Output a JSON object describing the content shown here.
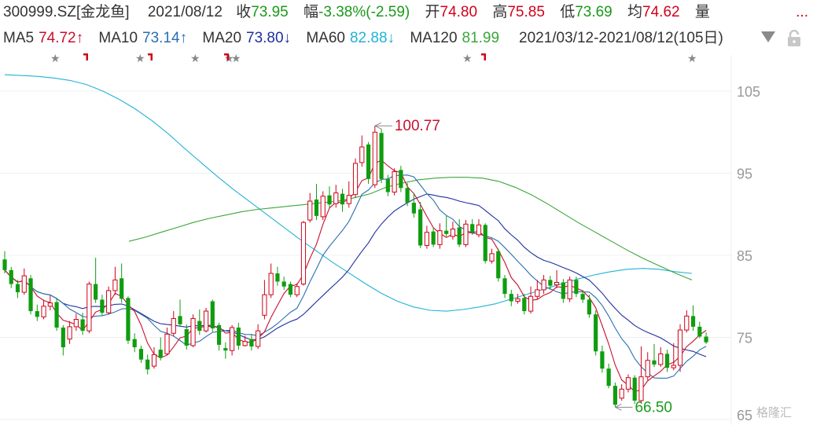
{
  "header": {
    "symbol": "300999.SZ[金龙鱼]",
    "date": "2021/08/12",
    "close_label": "收",
    "close": "73.95",
    "change_label": "幅",
    "change": "-3.38%(-2.59)",
    "open_label": "开",
    "open": "74.80",
    "high_label": "高",
    "high": "75.85",
    "low_label": "低",
    "low": "73.69",
    "avg_label": "均",
    "avg": "74.62",
    "vol_label": "量",
    "more": "..."
  },
  "ma_bar": {
    "items": [
      {
        "name": "MA5",
        "value": "74.72↑",
        "color": "#c8102e"
      },
      {
        "name": "MA10",
        "value": "73.14↑",
        "color": "#2a6fb0"
      },
      {
        "name": "MA20",
        "value": "73.80↓",
        "color": "#1f2fa0"
      },
      {
        "name": "MA60",
        "value": "82.88↓",
        "color": "#22b3d6"
      },
      {
        "name": "MA120",
        "value": "81.99",
        "color": "#3aa63a"
      }
    ],
    "range": "2021/03/12-2021/08/12(105日)"
  },
  "icons": {
    "dropdown": "triangle-down-icon",
    "lock": "lock-icon"
  },
  "watermark": "格隆汇",
  "colors": {
    "up": "#d0021b",
    "down": "#0f9d0f",
    "ma5": "#c8102e",
    "ma10": "#2a6fb0",
    "ma20": "#1f2fa0",
    "ma60": "#22b3d6",
    "ma120": "#3aa63a"
  },
  "chart_data": {
    "type": "candlestick",
    "y_ticks": [
      "105",
      "95",
      "85",
      "75",
      "65"
    ],
    "ylim": [
      64,
      110
    ],
    "annotations": [
      {
        "text": "100.77",
        "value": 100.77,
        "kind": "high"
      },
      {
        "text": "66.50",
        "value": 66.5,
        "kind": "low"
      }
    ],
    "candles": [
      [
        84.5,
        83.2,
        85.5,
        82.8
      ],
      [
        83.2,
        81.5,
        83.6,
        81.0
      ],
      [
        81.5,
        80.5,
        82.0,
        79.8
      ],
      [
        80.5,
        82.5,
        83.4,
        80.2
      ],
      [
        82.2,
        78.2,
        82.6,
        77.8
      ],
      [
        78.2,
        77.5,
        79.0,
        77.0
      ],
      [
        77.5,
        78.8,
        79.6,
        77.2
      ],
      [
        78.8,
        79.2,
        80.1,
        78.3
      ],
      [
        79.3,
        76.2,
        79.8,
        75.8
      ],
      [
        76.2,
        73.8,
        76.5,
        72.8
      ],
      [
        74.8,
        76.3,
        77.0,
        74.2
      ],
      [
        76.3,
        77.2,
        77.9,
        75.8
      ],
      [
        77.2,
        75.8,
        78.0,
        75.3
      ],
      [
        75.8,
        81.5,
        81.8,
        75.5
      ],
      [
        81.5,
        79.6,
        84.7,
        79.2
      ],
      [
        79.6,
        78.0,
        80.2,
        77.6
      ],
      [
        78.0,
        80.7,
        81.2,
        77.8
      ],
      [
        80.7,
        82.0,
        83.6,
        80.2
      ],
      [
        82.2,
        79.7,
        84.0,
        79.2
      ],
      [
        79.8,
        74.6,
        80.0,
        74.2
      ],
      [
        74.8,
        73.8,
        75.5,
        73.2
      ],
      [
        73.6,
        72.3,
        74.0,
        71.9
      ],
      [
        72.3,
        71.1,
        72.9,
        70.5
      ],
      [
        71.5,
        72.9,
        73.8,
        71.2
      ],
      [
        73.5,
        72.5,
        75.0,
        72.2
      ],
      [
        73.0,
        75.4,
        76.2,
        72.8
      ],
      [
        75.5,
        77.3,
        78.2,
        75.1
      ],
      [
        77.6,
        76.6,
        79.6,
        76.3
      ],
      [
        76.0,
        74.0,
        76.6,
        73.5
      ],
      [
        74.0,
        77.3,
        77.8,
        73.8
      ],
      [
        77.0,
        75.8,
        78.4,
        75.3
      ],
      [
        75.8,
        78.2,
        78.6,
        75.6
      ],
      [
        79.4,
        76.1,
        79.6,
        75.7
      ],
      [
        76.5,
        74.1,
        76.8,
        73.4
      ],
      [
        73.7,
        73.4,
        74.4,
        72.4
      ],
      [
        73.4,
        76.2,
        76.5,
        72.8
      ],
      [
        76.2,
        74.0,
        76.8,
        73.5
      ],
      [
        74.0,
        74.5,
        75.2,
        73.9
      ],
      [
        74.8,
        73.9,
        75.4,
        73.4
      ],
      [
        73.9,
        75.8,
        76.6,
        73.6
      ],
      [
        77.7,
        80.2,
        82.0,
        77.2
      ],
      [
        80.2,
        82.8,
        84.0,
        79.8
      ],
      [
        82.8,
        81.8,
        83.6,
        81.3
      ],
      [
        81.8,
        81.2,
        82.4,
        80.8
      ],
      [
        81.5,
        80.2,
        81.8,
        79.9
      ],
      [
        80.2,
        81.2,
        81.6,
        79.9
      ],
      [
        81.5,
        89.0,
        89.2,
        81.3
      ],
      [
        89.3,
        91.6,
        92.6,
        89.0
      ],
      [
        91.8,
        89.8,
        93.7,
        89.3
      ],
      [
        89.7,
        92.2,
        92.8,
        89.3
      ],
      [
        92.3,
        91.2,
        93.4,
        90.8
      ],
      [
        91.3,
        92.6,
        93.6,
        90.8
      ],
      [
        92.5,
        91.2,
        93.1,
        90.3
      ],
      [
        91.3,
        92.3,
        94.0,
        90.8
      ],
      [
        92.4,
        96.2,
        96.8,
        92.0
      ],
      [
        96.3,
        98.2,
        99.6,
        95.8
      ],
      [
        98.5,
        94.3,
        98.8,
        93.7
      ],
      [
        93.6,
        100.0,
        100.77,
        93.2
      ],
      [
        99.9,
        94.3,
        100.4,
        93.8
      ],
      [
        94.3,
        92.7,
        94.8,
        92.2
      ],
      [
        92.7,
        95.2,
        95.6,
        92.3
      ],
      [
        95.4,
        93.2,
        95.9,
        92.7
      ],
      [
        93.2,
        91.4,
        93.8,
        91.0
      ],
      [
        91.4,
        90.1,
        92.6,
        89.6
      ],
      [
        90.6,
        86.2,
        91.5,
        85.9
      ],
      [
        86.2,
        87.8,
        88.6,
        85.8
      ],
      [
        87.9,
        86.3,
        88.4,
        86.0
      ],
      [
        86.3,
        88.0,
        88.9,
        85.8
      ],
      [
        88.0,
        87.6,
        89.8,
        87.3
      ],
      [
        87.3,
        88.2,
        89.1,
        86.9
      ],
      [
        88.4,
        86.3,
        89.4,
        86.0
      ],
      [
        86.3,
        88.8,
        89.3,
        86.0
      ],
      [
        88.8,
        87.8,
        89.4,
        87.5
      ],
      [
        87.5,
        88.7,
        89.4,
        87.2
      ],
      [
        88.7,
        84.3,
        88.9,
        84.0
      ],
      [
        84.3,
        85.2,
        85.8,
        84.0
      ],
      [
        85.5,
        82.2,
        85.8,
        81.8
      ],
      [
        82.2,
        80.3,
        82.6,
        79.8
      ],
      [
        80.3,
        79.4,
        80.8,
        78.8
      ],
      [
        79.4,
        79.7,
        80.3,
        79.1
      ],
      [
        79.8,
        78.2,
        80.3,
        77.8
      ],
      [
        78.2,
        80.0,
        81.2,
        77.9
      ],
      [
        80.0,
        80.8,
        82.0,
        79.6
      ],
      [
        80.8,
        82.0,
        82.6,
        80.3
      ],
      [
        82.0,
        81.3,
        82.5,
        80.8
      ],
      [
        81.4,
        81.7,
        83.2,
        81.0
      ],
      [
        81.7,
        79.7,
        82.1,
        79.2
      ],
      [
        79.7,
        82.0,
        82.4,
        79.3
      ],
      [
        82.0,
        80.3,
        82.4,
        79.9
      ],
      [
        80.3,
        79.6,
        80.8,
        79.2
      ],
      [
        79.6,
        77.8,
        80.2,
        77.4
      ],
      [
        77.8,
        73.3,
        78.3,
        72.8
      ],
      [
        73.3,
        71.2,
        74.0,
        70.7
      ],
      [
        71.2,
        69.1,
        71.8,
        68.8
      ],
      [
        69.1,
        66.8,
        69.5,
        66.5
      ],
      [
        67.6,
        68.7,
        69.3,
        67.3
      ],
      [
        68.7,
        70.1,
        70.5,
        68.3
      ],
      [
        70.1,
        67.3,
        70.4,
        66.9
      ],
      [
        67.3,
        70.2,
        73.9,
        67.0
      ],
      [
        70.2,
        72.2,
        73.2,
        69.8
      ],
      [
        72.2,
        71.7,
        74.2,
        71.4
      ],
      [
        71.7,
        73.0,
        73.8,
        71.4
      ],
      [
        73.0,
        71.3,
        73.5,
        70.8
      ],
      [
        71.3,
        71.6,
        74.3,
        71.0
      ],
      [
        71.6,
        75.9,
        76.6,
        70.8
      ],
      [
        75.9,
        77.6,
        78.3,
        75.6
      ],
      [
        77.6,
        76.3,
        78.9,
        75.8
      ],
      [
        76.3,
        75.1,
        76.9,
        74.9
      ],
      [
        75.1,
        74.4,
        75.6,
        74.2
      ]
    ]
  }
}
